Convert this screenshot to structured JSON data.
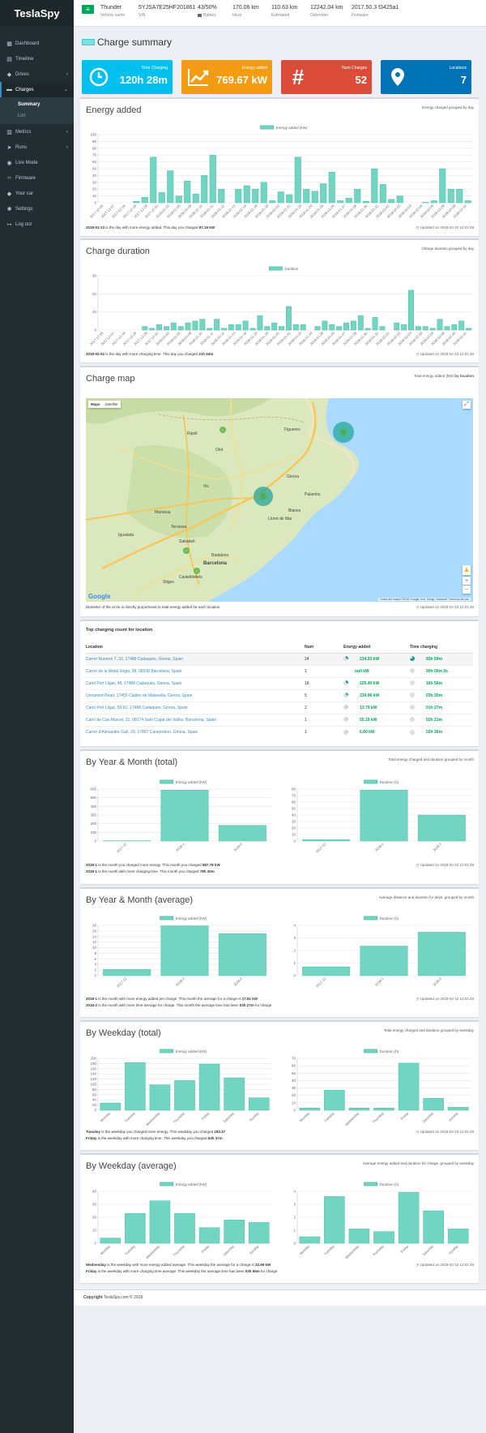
{
  "app": {
    "brand": "TeslaSpy"
  },
  "sidebar": {
    "items": [
      {
        "label": "Dashboard",
        "icon": "dashboard-icon"
      },
      {
        "label": "Timeline",
        "icon": "calendar-icon"
      },
      {
        "label": "Drives",
        "icon": "car-icon"
      },
      {
        "label": "Charges",
        "icon": "battery-icon"
      },
      {
        "label": "Metrics",
        "icon": "chart-icon"
      },
      {
        "label": "Runs",
        "icon": "run-icon"
      },
      {
        "label": "Live Mode",
        "icon": "eye-icon"
      },
      {
        "label": "Firmware",
        "icon": "code-icon"
      },
      {
        "label": "Your car",
        "icon": "car-icon"
      },
      {
        "label": "Settings",
        "icon": "gear-icon"
      },
      {
        "label": "Log out",
        "icon": "logout-icon"
      }
    ],
    "charges_sub": [
      "Summary",
      "List"
    ]
  },
  "topbar": {
    "vehicle_name": "Thunder",
    "vehicle_label": "Vehicle name",
    "vin": "5YJSA7E25HF201861",
    "vin_label": "VIN",
    "battery": "43/50%",
    "battery_label": "Battery",
    "ideal": "170.06 km",
    "ideal_label": "Ideal",
    "estimated": "110.63 km",
    "estimated_label": "Estimated",
    "odometer": "12242.04 km",
    "odometer_label": "Odometer",
    "firmware": "2017.50.3 f3425a1",
    "firmware_label": "Firmware"
  },
  "page": {
    "title": "Charge summary"
  },
  "kpis": [
    {
      "label": "Time Charging",
      "value": "120h 28m",
      "color": "#00c0ef"
    },
    {
      "label": "Energy added",
      "value": "769.67 kW",
      "color": "#f39c12"
    },
    {
      "label": "Num Charges",
      "value": "52",
      "color": "#dd4b39"
    },
    {
      "label": "Locations",
      "value": "7",
      "color": "#0073b7"
    }
  ],
  "energy_box": {
    "title": "Energy added",
    "tools": "Energy charged grouped by day",
    "note_bold": "2018-01-13",
    "note_text": " is the day with more energy added. This day you charged ",
    "note_val": "87.19 kW",
    "updated": "Updated on 2018-02-10 12:01:49"
  },
  "duration_box": {
    "title": "Charge duration",
    "tools": "Charge duration grouped by day",
    "note_bold": "2018-02-02",
    "note_text": " is the day with more charging time. This day you charged ",
    "note_val": "21h 53m",
    "updated": "Updated on 2018-02-10 12:01:49"
  },
  "map_box": {
    "title": "Charge map",
    "tools_a": "Total energy added (kW) ",
    "tools_b": "by location",
    "btn_map": "Maps",
    "btn_sat": "Satellite",
    "note": "Diameter of the circle is directly proportional to total energy added for each location",
    "updated": "Updated on 2018-02-10 12:01:49",
    "attribution": "Datos del mapa ©2018 Google, Inst. Geogr. Nacional     Términos de uso",
    "logo": "Google",
    "places": [
      "Figueres",
      "Girona",
      "Barcelona",
      "Sabadell",
      "Badalona",
      "Olot",
      "Vic",
      "Manresa",
      "Terrassa",
      "Blanes",
      "Lloret de Mar",
      "Sitges",
      "Ripoll",
      "Castelldefels",
      "Igualada",
      "Palamós"
    ]
  },
  "locations_box": {
    "title": "Top charging count for location",
    "headers": [
      "Location",
      "Num",
      "Energy added",
      "Time charging"
    ],
    "rows": [
      {
        "loc": "Carrer Numero 7, 32, 17488 Cadaqués, Girona, Spain",
        "num": "24",
        "energy": "234.33 kW",
        "time": "93h 50m"
      },
      {
        "loc": "Carrer de la Metal·lúrgia, 38, 08038 Barcelona, Spain",
        "num": "1",
        "energy": "null kW",
        "time": "00h 00m 0s"
      },
      {
        "loc": "Camí Port Lligat, 48, 17488 Cadaqués, Girona, Spain",
        "num": "18",
        "energy": "225.40 kW",
        "time": "16h 56m"
      },
      {
        "loc": "Unnamed Road, 17455 Caldes de Malavella, Girona, Spain",
        "num": "5",
        "energy": "234.96 kW",
        "time": "03h 20m"
      },
      {
        "loc": "Camí Port Lligat, 59-61, 17488 Cadaqués, Girona, Spain",
        "num": "2",
        "energy": "13.79 kW",
        "time": "01h 27m"
      },
      {
        "loc": "Camí de Can Marcet, 31, 08174 Sant Cugat del Vallès, Barcelona, Spain",
        "num": "1",
        "energy": "55.19 kW",
        "time": "02h 21m"
      },
      {
        "loc": "Carrer d'Alexandre Galí, 23, 17867 Camprodon, Girona, Spain",
        "num": "1",
        "energy": "6.00 kW",
        "time": "02h 30m"
      }
    ]
  },
  "ym_total_box": {
    "title": "By Year & Month (total)",
    "tools": "Total energy charged and duration grouped by month",
    "note1_bold": "2018-1",
    "note1_text": " is the month you charged more energy. This month you charged ",
    "note1_val": "587.78 kW",
    "note2_bold": "2018-1",
    "note2_text": " is the month with more charging time. This month you charged ",
    "note2_val": "78h 30m",
    "updated": "Updated on 2018-02-10 12:01:49"
  },
  "ym_avg_box": {
    "title": "By Year & Month (average)",
    "tools": "Average distance and duration for drive, grouped by month",
    "note1_bold": "2018-1",
    "note1_text": " is the month with more energy added per charge. This month the average for a charge is ",
    "note1_val": "17.81 kW",
    "note2_bold": "2018-2",
    "note2_text": " is the month with more time average for charge. This month the average time has been ",
    "note2_val": "03h 27m",
    "note2_tail": " for charge",
    "updated": "Updated on 2018-02-10 12:01:49"
  },
  "wd_total_box": {
    "title": "By Weekday (total)",
    "tools": "Total energy charged and duration grouped by weekday",
    "note1_bold": "Tuesday",
    "note1_text": " is the weekday you charged more energy. This weekday you charged ",
    "note1_val": "183.37",
    "note2_bold": "Friday",
    "note2_text": " is the weekday with more charging time. This weekday you charged ",
    "note2_val": "63h 37m",
    "updated": "Updated on 2018-02-10 12:01:49"
  },
  "wd_avg_box": {
    "title": "By Weekday (average)",
    "tools": "Average energy added and duration for charge, grouped by weekday",
    "note1_bold": "Wednesday",
    "note1_text": " is the weekday with more energy added average. This weekday the average for a charge is ",
    "note1_val": "32.69 kW",
    "note2_bold": "Friday",
    "note2_text": " is the weekday with more charging time average. This weekday the average time has been ",
    "note2_val": "03h 56m",
    "note2_tail": " for charge",
    "updated": "Updated on 2018-02-10 12:01:49"
  },
  "footer": {
    "bold": "Copyright",
    "text": " TeslaSpy.com © 2018"
  },
  "chart_data": [
    {
      "id": "energy_daily",
      "type": "bar",
      "legend": "Energy added (kW)",
      "ylim": [
        0,
        100
      ],
      "yticks": [
        0,
        10,
        20,
        30,
        40,
        50,
        60,
        70,
        80,
        90,
        100
      ],
      "color": "#71d5c1",
      "categories": [
        "2017-12-05",
        "2017-12-07",
        "2017-12-16",
        "2017-12-18",
        "2017-12-28",
        "2017-12-31",
        "2018-01-02",
        "2018-01-05",
        "2018-01-08",
        "2018-01-10",
        "2018-01-11",
        "2018-01-12",
        "2018-01-13",
        "2018-01-14",
        "2018-01-15",
        "2018-01-18",
        "2018-01-20",
        "2018-01-21",
        "2018-01-23",
        "2018-01-24",
        "2018-01-25",
        "2018-01-26",
        "2018-01-27",
        "2018-01-28",
        "2018-01-30",
        "2018-01-31",
        "2018-02-01",
        "2018-02-02",
        "2018-02-03",
        "2018-02-04",
        "2018-02-05",
        "2018-02-08",
        "2018-02-09",
        "2018-02-10"
      ],
      "values": [
        0,
        0,
        0,
        0,
        2,
        8,
        67,
        15,
        47,
        10,
        32,
        13,
        40,
        70,
        20,
        0,
        20,
        25,
        20,
        30,
        3,
        16,
        12,
        67,
        20,
        17,
        28,
        45,
        3,
        7,
        20,
        2,
        50,
        27,
        5,
        10,
        0,
        0,
        1,
        3,
        50,
        20,
        20,
        3
      ]
    },
    {
      "id": "duration_daily",
      "type": "bar",
      "legend": "Duration",
      "ylim": [
        0,
        30
      ],
      "yticks": [
        0,
        10,
        20,
        30
      ],
      "color": "#71d5c1",
      "categories": [
        "2017-12-05",
        "2017-12-07",
        "2017-12-16",
        "2017-12-18",
        "2017-12-28",
        "2017-12-31",
        "2018-01-02",
        "2018-01-05",
        "2018-01-08",
        "2018-01-10",
        "2018-01-11",
        "2018-01-12",
        "2018-01-13",
        "2018-01-14",
        "2018-01-15",
        "2018-01-18",
        "2018-01-20",
        "2018-01-21",
        "2018-01-23",
        "2018-01-24",
        "2018-01-25",
        "2018-01-26",
        "2018-01-27",
        "2018-01-28",
        "2018-01-30",
        "2018-01-31",
        "2018-02-01",
        "2018-02-02",
        "2018-02-03",
        "2018-02-04",
        "2018-02-05",
        "2018-02-08",
        "2018-02-09",
        "2018-02-10"
      ],
      "values": [
        0,
        0,
        0,
        0,
        0,
        0,
        2,
        1,
        3,
        2,
        4,
        2,
        4,
        5,
        6,
        1,
        6,
        1,
        3,
        3,
        5,
        1,
        8,
        2,
        4,
        2,
        13,
        3,
        3,
        0,
        2,
        5,
        3,
        2,
        4,
        5,
        8,
        1,
        7,
        2,
        0,
        4,
        3,
        22,
        2,
        2,
        1,
        6,
        2,
        3,
        5,
        1
      ]
    },
    {
      "id": "ym_total_energy",
      "type": "bar",
      "legend": "Energy added (kW)",
      "ylim": [
        0,
        600
      ],
      "yticks": [
        0,
        100,
        200,
        300,
        400,
        500,
        600
      ],
      "color": "#71d5c1",
      "categories": [
        "2017-12",
        "2018-1",
        "2018-2"
      ],
      "values": [
        3,
        587.78,
        180
      ]
    },
    {
      "id": "ym_total_duration",
      "type": "bar",
      "legend": "Duration (h)",
      "ylim": [
        0,
        80
      ],
      "yticks": [
        0,
        10,
        20,
        30,
        40,
        50,
        60,
        70,
        80
      ],
      "color": "#71d5c1",
      "categories": [
        "2017-12",
        "2018-1",
        "2018-2"
      ],
      "values": [
        2,
        78.5,
        40
      ]
    },
    {
      "id": "ym_avg_energy",
      "type": "bar",
      "legend": "Energy added (kW)",
      "ylim": [
        0,
        18
      ],
      "yticks": [
        0,
        2,
        4,
        6,
        8,
        10,
        12,
        14,
        16,
        18
      ],
      "color": "#71d5c1",
      "categories": [
        "2017-12",
        "2018-1",
        "2018-2"
      ],
      "values": [
        2.2,
        17.81,
        15
      ]
    },
    {
      "id": "ym_avg_duration",
      "type": "bar",
      "legend": "Duration (h)",
      "ylim": [
        0,
        4
      ],
      "yticks": [
        0,
        1,
        2,
        3,
        4
      ],
      "color": "#71d5c1",
      "categories": [
        "2017-12",
        "2018-1",
        "2018-2"
      ],
      "values": [
        0.7,
        2.35,
        3.45
      ]
    },
    {
      "id": "wd_total_energy",
      "type": "bar",
      "legend": "Energy added (kW)",
      "ylim": [
        0,
        200
      ],
      "yticks": [
        0,
        20,
        40,
        60,
        80,
        100,
        120,
        140,
        160,
        180,
        200
      ],
      "color": "#71d5c1",
      "categories": [
        "Monday",
        "Tuesday",
        "Wednesday",
        "Thursday",
        "Friday",
        "Saturday",
        "Sunday"
      ],
      "values": [
        28,
        183.37,
        98,
        115,
        178,
        125,
        48
      ]
    },
    {
      "id": "wd_total_duration",
      "type": "bar",
      "legend": "Duration (h)",
      "ylim": [
        0,
        70
      ],
      "yticks": [
        0,
        10,
        20,
        30,
        40,
        50,
        60,
        70
      ],
      "color": "#71d5c1",
      "categories": [
        "Monday",
        "Tuesday",
        "Wednesday",
        "Thursday",
        "Friday",
        "Saturday",
        "Sunday"
      ],
      "values": [
        3,
        27,
        3,
        3,
        63.6,
        16,
        4
      ]
    },
    {
      "id": "wd_avg_energy",
      "type": "bar",
      "legend": "Energy added (kW)",
      "ylim": [
        0,
        40
      ],
      "yticks": [
        0,
        10,
        20,
        30,
        40
      ],
      "color": "#71d5c1",
      "categories": [
        "Monday",
        "Tuesday",
        "Wednesday",
        "Thursday",
        "Friday",
        "Saturday",
        "Sunday"
      ],
      "values": [
        4,
        23,
        32.69,
        23,
        12,
        18,
        16
      ]
    },
    {
      "id": "wd_avg_duration",
      "type": "bar",
      "legend": "Duration (h)",
      "ylim": [
        0,
        4
      ],
      "yticks": [
        0,
        1,
        2,
        3,
        4
      ],
      "color": "#71d5c1",
      "categories": [
        "Monday",
        "Tuesday",
        "Wednesday",
        "Thursday",
        "Friday",
        "Saturday",
        "Sunday"
      ],
      "values": [
        0.5,
        3.6,
        1.1,
        0.9,
        3.93,
        2.5,
        1.1
      ]
    }
  ]
}
